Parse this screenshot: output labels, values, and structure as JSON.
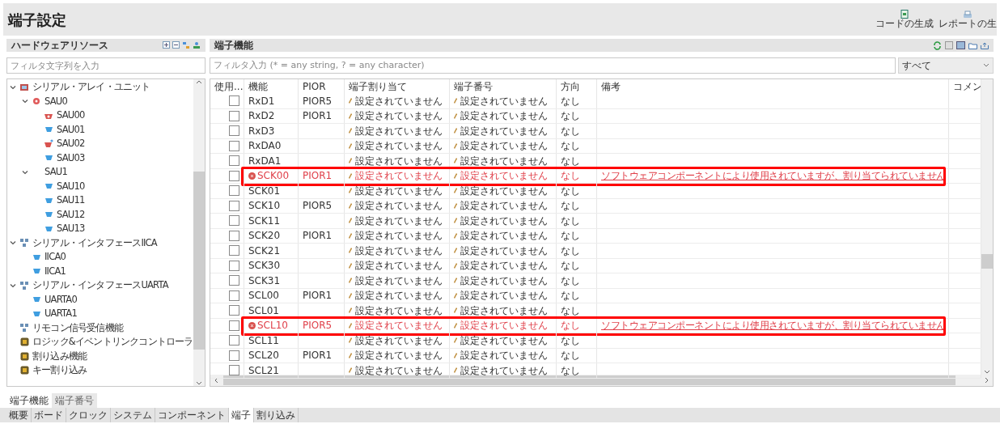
{
  "title": "端子設定",
  "toolbar": [
    {
      "label": "コードの生成",
      "kind": "code"
    },
    {
      "label": "レポートの生",
      "kind": "report"
    }
  ],
  "resources": {
    "title": "ハードウェアリソース",
    "filter": {
      "placeholder": "フィルタ文字列を入力"
    },
    "tree": [
      {
        "label": "シリアル・アレイ・ユニット",
        "kind": "unit",
        "expanded": true,
        "children": [
          {
            "label": "SAU0",
            "kind": "dot",
            "expanded": true,
            "children": [
              {
                "label": "SAU00",
                "kind": "error"
              },
              {
                "label": "SAU01",
                "kind": "ok"
              },
              {
                "label": "SAU02",
                "kind": "warning"
              },
              {
                "label": "SAU03",
                "kind": "ok"
              }
            ]
          },
          {
            "label": "SAU1",
            "kind": "plain",
            "expanded": true,
            "children": [
              {
                "label": "SAU10",
                "kind": "ok"
              },
              {
                "label": "SAU11",
                "kind": "ok"
              },
              {
                "label": "SAU12",
                "kind": "ok"
              },
              {
                "label": "SAU13",
                "kind": "ok"
              }
            ]
          }
        ]
      },
      {
        "label": "シリアル・インタフェースIICA",
        "kind": "net",
        "expanded": true,
        "children": [
          {
            "label": "IICA0",
            "kind": "ok"
          },
          {
            "label": "IICA1",
            "kind": "ok"
          }
        ]
      },
      {
        "label": "シリアル・インタフェースUARTA",
        "kind": "net",
        "expanded": true,
        "children": [
          {
            "label": "UARTA0",
            "kind": "ok"
          },
          {
            "label": "UARTA1",
            "kind": "ok"
          }
        ]
      },
      {
        "label": "リモコン信号受信機能",
        "kind": "net"
      },
      {
        "label": "ロジック&イベントリンクコントローラ",
        "kind": "chip"
      },
      {
        "label": "割り込み機能",
        "kind": "chip"
      },
      {
        "label": "キー割り込み",
        "kind": "chip"
      }
    ]
  },
  "functions": {
    "title": "端子機能",
    "filter": {
      "placeholder": "フィルタ入力 (* = any string, ? = any character)"
    },
    "scope": "すべて",
    "table": {
      "columns": [
        "使用...",
        "機能",
        "PIOR",
        "端子割り当て",
        "端子番号",
        "方向",
        "備考",
        "コメン"
      ],
      "rows": [
        {
          "checked": false,
          "error": false,
          "highlighted": false,
          "function": "RxD1",
          "pior": "PIOR5",
          "assign": "設定されていません",
          "pin": "設定されていません",
          "direction": "なし"
        },
        {
          "checked": false,
          "error": false,
          "highlighted": false,
          "function": "RxD2",
          "pior": "PIOR1",
          "assign": "設定されていません",
          "pin": "設定されていません",
          "direction": "なし"
        },
        {
          "checked": false,
          "error": false,
          "highlighted": false,
          "function": "RxD3",
          "assign": "設定されていません",
          "pin": "設定されていません",
          "direction": "なし"
        },
        {
          "checked": false,
          "error": false,
          "highlighted": false,
          "function": "RxDA0",
          "assign": "設定されていません",
          "pin": "設定されていません",
          "direction": "なし"
        },
        {
          "checked": false,
          "error": false,
          "highlighted": false,
          "function": "RxDA1",
          "assign": "設定されていません",
          "pin": "設定されていません",
          "direction": "なし"
        },
        {
          "checked": false,
          "error": true,
          "highlighted": true,
          "function": "SCK00",
          "pior": "PIOR1",
          "assign": "設定されていません",
          "pin": "設定されていません",
          "direction": "なし",
          "note": "ソフトウェアコンポーネントにより使用されていますが、割り当てられていません"
        },
        {
          "checked": false,
          "error": false,
          "highlighted": false,
          "function": "SCK01",
          "assign": "設定されていません",
          "pin": "設定されていません",
          "direction": "なし"
        },
        {
          "checked": false,
          "error": false,
          "highlighted": false,
          "function": "SCK10",
          "pior": "PIOR5",
          "assign": "設定されていません",
          "pin": "設定されていません",
          "direction": "なし"
        },
        {
          "checked": false,
          "error": false,
          "highlighted": false,
          "function": "SCK11",
          "assign": "設定されていません",
          "pin": "設定されていません",
          "direction": "なし"
        },
        {
          "checked": false,
          "error": false,
          "highlighted": false,
          "function": "SCK20",
          "pior": "PIOR1",
          "assign": "設定されていません",
          "pin": "設定されていません",
          "direction": "なし"
        },
        {
          "checked": false,
          "error": false,
          "highlighted": false,
          "function": "SCK21",
          "assign": "設定されていません",
          "pin": "設定されていません",
          "direction": "なし"
        },
        {
          "checked": false,
          "error": false,
          "highlighted": false,
          "function": "SCK30",
          "assign": "設定されていません",
          "pin": "設定されていません",
          "direction": "なし"
        },
        {
          "checked": false,
          "error": false,
          "highlighted": false,
          "function": "SCK31",
          "assign": "設定されていません",
          "pin": "設定されていません",
          "direction": "なし"
        },
        {
          "checked": false,
          "error": false,
          "highlighted": false,
          "function": "SCL00",
          "pior": "PIOR1",
          "assign": "設定されていません",
          "pin": "設定されていません",
          "direction": "なし"
        },
        {
          "checked": false,
          "error": false,
          "highlighted": false,
          "function": "SCL01",
          "assign": "設定されていません",
          "pin": "設定されていません",
          "direction": "なし"
        },
        {
          "checked": false,
          "error": true,
          "highlighted": true,
          "function": "SCL10",
          "pior": "PIOR5",
          "assign": "設定されていません",
          "pin": "設定されていません",
          "direction": "なし",
          "note": "ソフトウェアコンポーネントにより使用されていますが、割り当てられていません"
        },
        {
          "checked": false,
          "error": false,
          "highlighted": false,
          "function": "SCL11",
          "assign": "設定されていません",
          "pin": "設定されていません",
          "direction": "なし"
        },
        {
          "checked": false,
          "error": false,
          "highlighted": false,
          "function": "SCL20",
          "pior": "PIOR1",
          "assign": "設定されていません",
          "pin": "設定されていません",
          "direction": "なし"
        },
        {
          "checked": false,
          "error": false,
          "highlighted": false,
          "function": "SCL21",
          "assign": "設定されていません",
          "pin": "設定されていません",
          "direction": "なし"
        }
      ]
    }
  },
  "view_tabs": [
    {
      "label": "端子機能",
      "selected": true
    },
    {
      "label": "端子番号",
      "selected": false
    }
  ],
  "page_tabs": [
    {
      "label": "概要",
      "selected": false
    },
    {
      "label": "ボード",
      "selected": false
    },
    {
      "label": "クロック",
      "selected": false
    },
    {
      "label": "システム",
      "selected": false
    },
    {
      "label": "コンポーネント",
      "selected": false
    },
    {
      "label": "端子",
      "selected": true
    },
    {
      "label": "割り込み",
      "selected": false
    }
  ]
}
